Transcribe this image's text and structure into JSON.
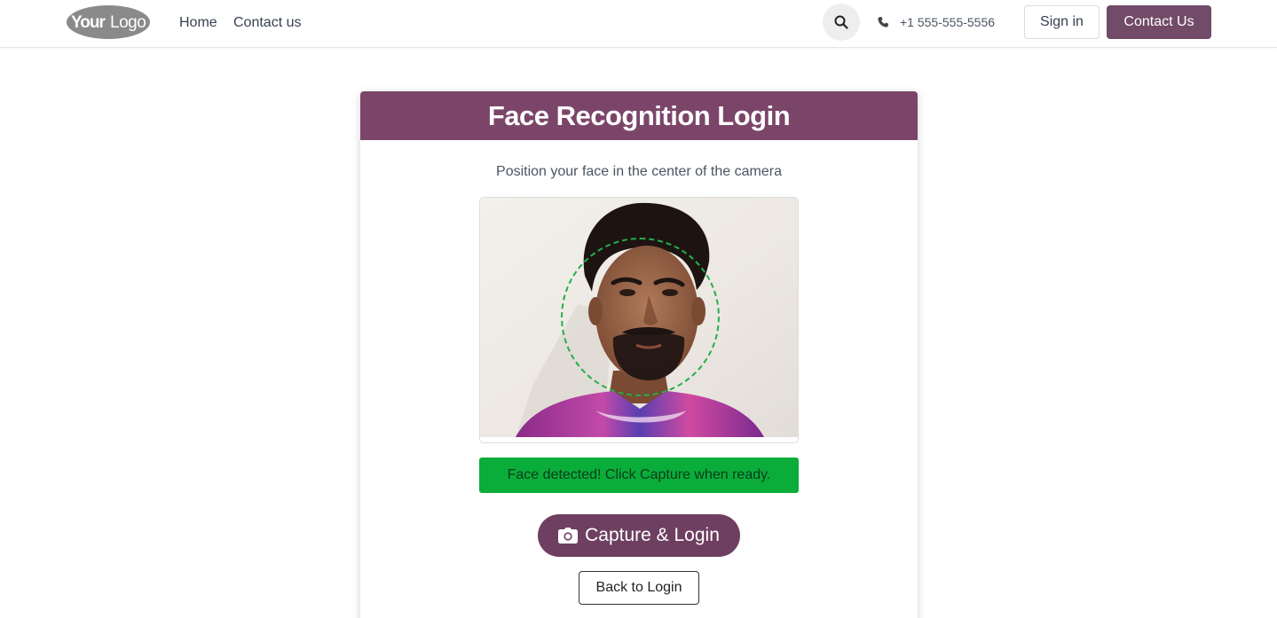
{
  "header": {
    "logo_text": "YourLogo",
    "nav": [
      {
        "label": "Home"
      },
      {
        "label": "Contact us"
      }
    ],
    "phone": "+1 555-555-5556",
    "sign_in_label": "Sign in",
    "contact_label": "Contact Us",
    "icons": {
      "search": "search-icon",
      "phone": "phone-icon"
    }
  },
  "card": {
    "title": "Face Recognition Login",
    "instruction": "Position your face in the center of the camera",
    "status": "Face detected! Click Capture when ready.",
    "capture_label": "Capture & Login",
    "back_label": "Back to Login",
    "icons": {
      "capture": "camera-icon"
    }
  },
  "colors": {
    "brand": "#714b67",
    "card_header": "#7b4569",
    "status_bg": "#0bad3a",
    "guide": "#22b04c"
  }
}
